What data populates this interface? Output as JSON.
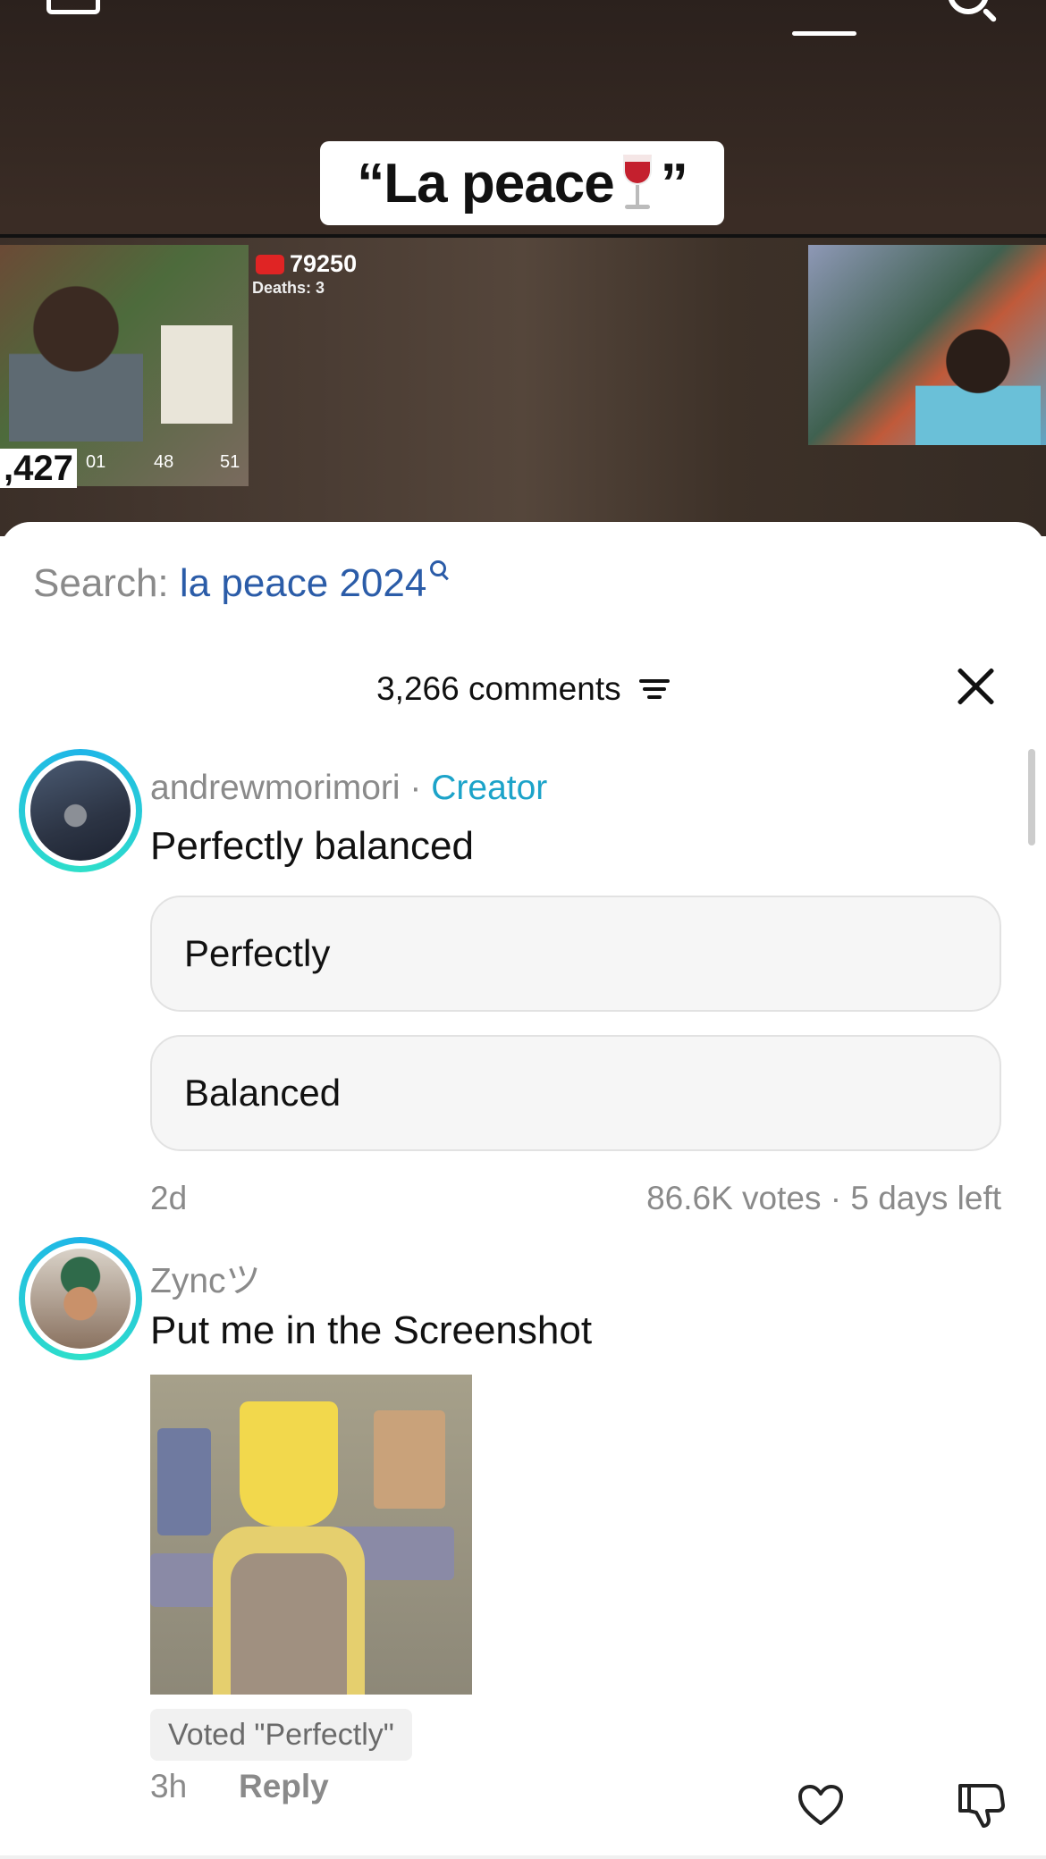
{
  "video": {
    "caption": "“La peace",
    "caption_end": "”",
    "youtube_count": "79250",
    "deaths": "Deaths: 3",
    "timer": {
      "main": ",427",
      "hours": "01",
      "minutes": "48",
      "seconds": "51"
    }
  },
  "sheet": {
    "search_prefix": "Search: ",
    "search_query": "la peace 2024",
    "comments_count": "3,266 comments"
  },
  "comments": [
    {
      "username": "andrewmorimori",
      "separator": " · ",
      "badge": "Creator",
      "text": "Perfectly balanced",
      "poll": {
        "options": [
          "Perfectly",
          "Balanced"
        ],
        "votes": "86.6K votes · 5 days left"
      },
      "time": "2d"
    },
    {
      "username": "Zyncツ",
      "text": "Put me in the Screenshot",
      "voted": "Voted \"Perfectly\"",
      "time": "3h",
      "reply_label": "Reply"
    }
  ],
  "colors": {
    "creator": "#1ca3c9",
    "search_query": "#2b5ca8",
    "ring_start": "#1fb5e8",
    "ring_end": "#2ee0c9"
  }
}
